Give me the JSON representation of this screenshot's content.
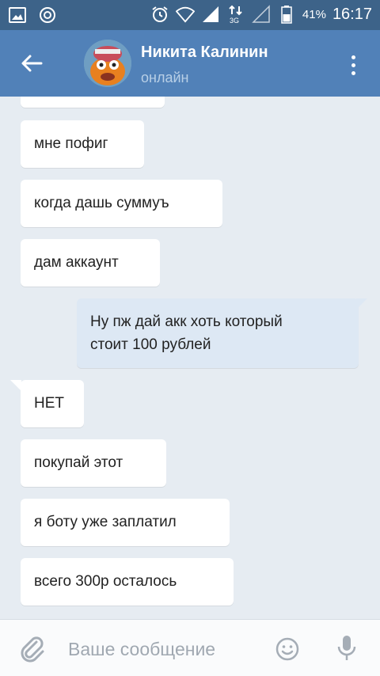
{
  "status_bar": {
    "battery": "41%",
    "network": "3G",
    "time": "16:17",
    "icons": [
      "gallery-icon",
      "sync-icon",
      "alarm-icon",
      "wifi-icon",
      "signal-icon",
      "data-arrows-icon",
      "signal-empty-icon",
      "battery-icon"
    ]
  },
  "header": {
    "name": "Никита Калинин",
    "status": "онлайн"
  },
  "messages": [
    {
      "dir": "in",
      "text": ""
    },
    {
      "dir": "in",
      "text": "мне пофиг"
    },
    {
      "dir": "in",
      "text": "когда дашь суммуъ"
    },
    {
      "dir": "in",
      "text": "дам аккаунт"
    },
    {
      "dir": "out",
      "line1": "Ну пж дай акк хоть который",
      "line2": "стоит 100 рублей"
    },
    {
      "dir": "in",
      "text": "НЕТ"
    },
    {
      "dir": "in",
      "text": "покупай этот"
    },
    {
      "dir": "in",
      "text": "я боту уже заплатил"
    },
    {
      "dir": "in",
      "text": "всего 300р осталось"
    }
  ],
  "composer": {
    "placeholder": "Ваше сообщение",
    "value": ""
  },
  "colors": {
    "status_bar": "#3d6389",
    "app_bar": "#5181b8",
    "background": "#e6ecf2",
    "incoming_bubble": "#ffffff",
    "outgoing_bubble": "#dde8f4"
  }
}
